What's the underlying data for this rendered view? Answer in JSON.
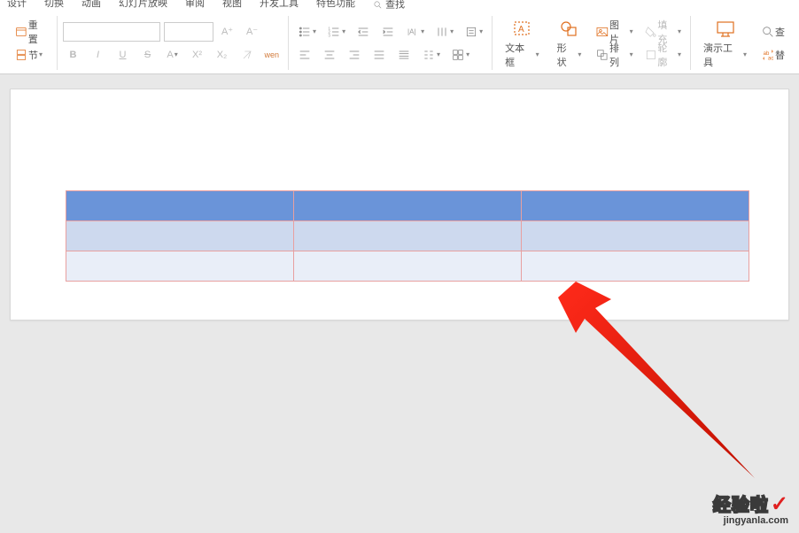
{
  "menu": {
    "design": "设计",
    "switch": "切换",
    "animation": "动画",
    "slideshow": "幻灯片放映",
    "review": "审阅",
    "view": "视图",
    "devtools": "开发工具",
    "features": "特色功能",
    "search": "查找"
  },
  "ribbon": {
    "reset": "重置",
    "section": "节",
    "font_name": "",
    "font_size": "",
    "bold": "B",
    "italic": "I",
    "underline": "U",
    "strike": "S",
    "fontA": "A",
    "super": "X²",
    "sub": "X₂",
    "wen": "wen",
    "ap": "A⁺",
    "am": "A⁻",
    "textbox": "文本框",
    "shape": "形状",
    "image": "图片",
    "arrange": "排列",
    "fill": "填充",
    "outline": "轮廓",
    "present": "演示工具",
    "search2": "查",
    "ti": "替"
  },
  "watermark": {
    "line1": "经验啦",
    "line2": "jingyanla.com"
  }
}
